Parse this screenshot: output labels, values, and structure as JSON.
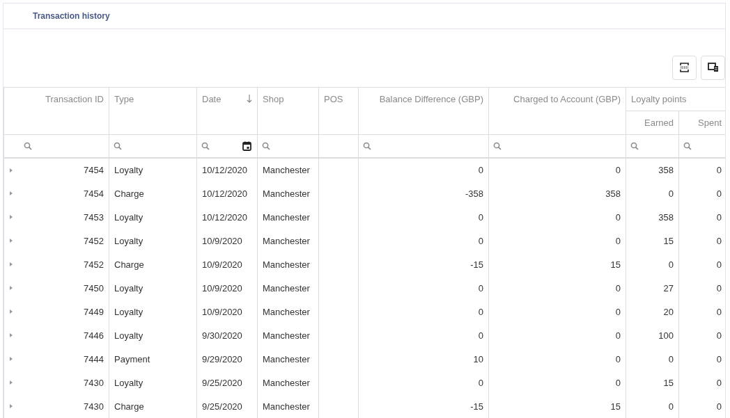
{
  "panel": {
    "title": "Transaction history"
  },
  "columns": [
    {
      "label": "Transaction ID",
      "right_aligned": true,
      "search_filter": true
    },
    {
      "label": "Type",
      "right_aligned": false,
      "search_filter": true
    },
    {
      "label": "Date",
      "right_aligned": false,
      "search_filter": true,
      "date_picker": true,
      "sorted_descending": true
    },
    {
      "label": "Shop",
      "right_aligned": false,
      "search_filter": true
    },
    {
      "label": "POS",
      "right_aligned": false,
      "search_filter": false
    },
    {
      "label": "Balance Difference (GBP)",
      "right_aligned": true,
      "search_filter": true
    },
    {
      "label": "Charged to Account (GBP)",
      "right_aligned": true,
      "search_filter": true
    },
    {
      "label": "Loyalty points",
      "right_aligned": false,
      "children": [
        {
          "label": "Earned",
          "right_aligned": true,
          "search_filter": true
        },
        {
          "label": "Spent",
          "right_aligned": true,
          "search_filter": true
        }
      ]
    }
  ],
  "rows": [
    {
      "expanded": false,
      "cells": [
        "7454",
        "Loyalty",
        "10/12/2020",
        "Manchester",
        "",
        "0",
        "0",
        "358",
        "0"
      ]
    },
    {
      "expanded": false,
      "cells": [
        "7454",
        "Charge",
        "10/12/2020",
        "Manchester",
        "",
        "-358",
        "358",
        "0",
        "0"
      ]
    },
    {
      "expanded": false,
      "cells": [
        "7453",
        "Loyalty",
        "10/12/2020",
        "Manchester",
        "",
        "0",
        "0",
        "358",
        "0"
      ]
    },
    {
      "expanded": false,
      "cells": [
        "7452",
        "Loyalty",
        "10/9/2020",
        "Manchester",
        "",
        "0",
        "0",
        "15",
        "0"
      ]
    },
    {
      "expanded": false,
      "cells": [
        "7452",
        "Charge",
        "10/9/2020",
        "Manchester",
        "",
        "-15",
        "15",
        "0",
        "0"
      ]
    },
    {
      "expanded": false,
      "cells": [
        "7450",
        "Loyalty",
        "10/9/2020",
        "Manchester",
        "",
        "0",
        "0",
        "27",
        "0"
      ]
    },
    {
      "expanded": false,
      "cells": [
        "7449",
        "Loyalty",
        "10/9/2020",
        "Manchester",
        "",
        "0",
        "0",
        "20",
        "0"
      ]
    },
    {
      "expanded": false,
      "cells": [
        "7446",
        "Loyalty",
        "9/30/2020",
        "Manchester",
        "",
        "0",
        "0",
        "100",
        "0"
      ]
    },
    {
      "expanded": false,
      "cells": [
        "7444",
        "Payment",
        "9/29/2020",
        "Manchester",
        "",
        "10",
        "0",
        "0",
        "0"
      ]
    },
    {
      "expanded": false,
      "cells": [
        "7430",
        "Loyalty",
        "9/25/2020",
        "Manchester",
        "",
        "0",
        "0",
        "15",
        "0"
      ]
    },
    {
      "expanded": false,
      "cells": [
        "7430",
        "Charge",
        "9/25/2020",
        "Manchester",
        "",
        "-15",
        "15",
        "0",
        "0"
      ]
    }
  ]
}
